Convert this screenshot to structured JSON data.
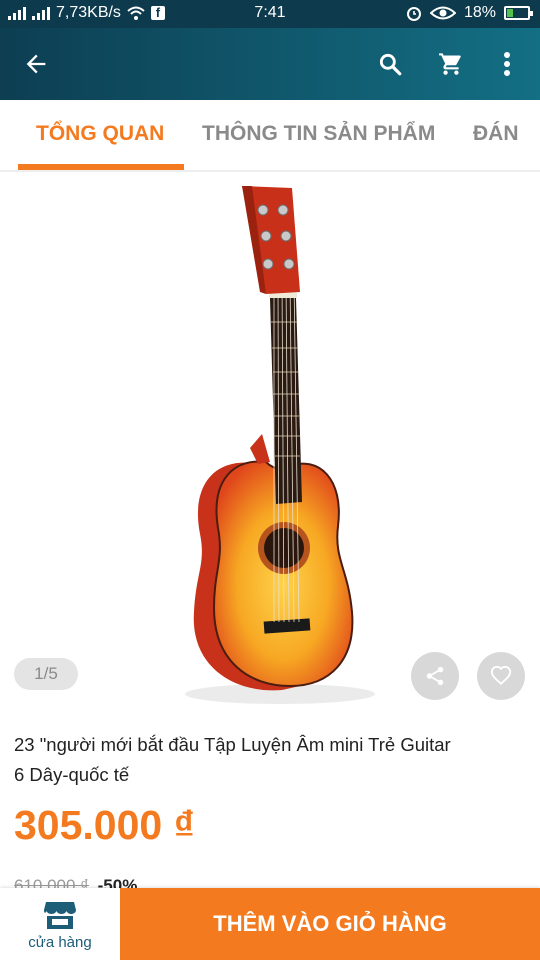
{
  "status_bar": {
    "network_speed": "7,73KB/s",
    "time": "7:41",
    "battery_percent": "18%",
    "fb_glyph": "f",
    "icons": [
      "signal-icon",
      "wifi-icon",
      "facebook-icon",
      "alarm-icon",
      "eye-icon",
      "battery-icon"
    ]
  },
  "app_bar": {
    "icons": [
      "back-arrow-icon",
      "search-icon",
      "cart-icon",
      "more-vertical-icon"
    ],
    "background": "#0d3e52",
    "background_end": "#136f84"
  },
  "tabs": [
    {
      "label": "TỔNG QUAN",
      "active": true
    },
    {
      "label": "THÔNG TIN SẢN PHẨM",
      "active": false
    },
    {
      "label": "ĐÁN",
      "active": false
    }
  ],
  "gallery": {
    "pager": "1/5",
    "icons": [
      "share-icon",
      "heart-icon"
    ]
  },
  "product": {
    "title_line1": "23 \"người mới bắt đầu Tập Luyện Âm mini Trẻ Guitar",
    "title_line2": "6 Dây-quốc tế",
    "price": "305.000 ₫",
    "old_price": "610.000 ₫",
    "discount": "-50%"
  },
  "bottom_bar": {
    "store_label": "cửa hàng",
    "add_to_cart_label": "THÊM VÀO GIỎ HÀNG"
  },
  "colors": {
    "accent": "#f47a20",
    "header": "#0d3e52",
    "status_bar": "#0d3a4c"
  }
}
